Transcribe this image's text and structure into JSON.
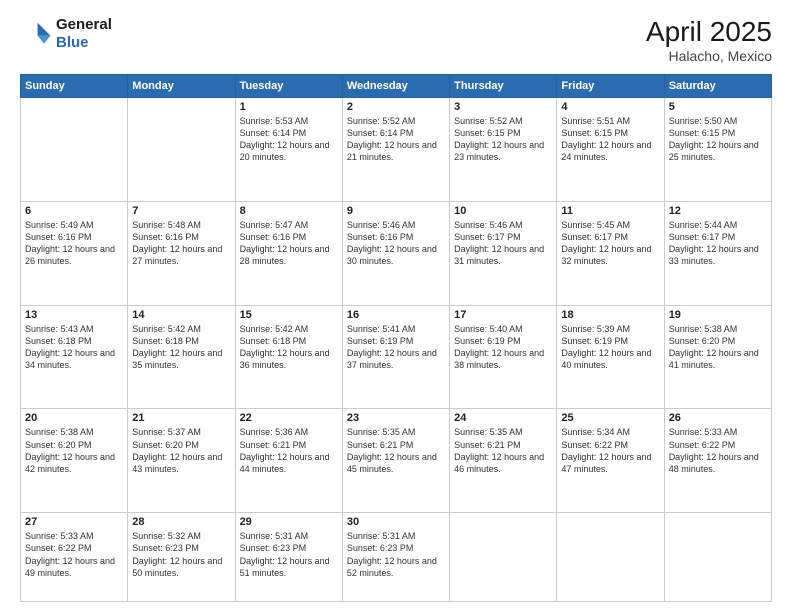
{
  "logo": {
    "line1": "General",
    "line2": "Blue"
  },
  "title": {
    "month_year": "April 2025",
    "location": "Halacho, Mexico"
  },
  "days_of_week": [
    "Sunday",
    "Monday",
    "Tuesday",
    "Wednesday",
    "Thursday",
    "Friday",
    "Saturday"
  ],
  "weeks": [
    [
      {
        "day": "",
        "text": ""
      },
      {
        "day": "",
        "text": ""
      },
      {
        "day": "1",
        "text": "Sunrise: 5:53 AM\nSunset: 6:14 PM\nDaylight: 12 hours and 20 minutes."
      },
      {
        "day": "2",
        "text": "Sunrise: 5:52 AM\nSunset: 6:14 PM\nDaylight: 12 hours and 21 minutes."
      },
      {
        "day": "3",
        "text": "Sunrise: 5:52 AM\nSunset: 6:15 PM\nDaylight: 12 hours and 23 minutes."
      },
      {
        "day": "4",
        "text": "Sunrise: 5:51 AM\nSunset: 6:15 PM\nDaylight: 12 hours and 24 minutes."
      },
      {
        "day": "5",
        "text": "Sunrise: 5:50 AM\nSunset: 6:15 PM\nDaylight: 12 hours and 25 minutes."
      }
    ],
    [
      {
        "day": "6",
        "text": "Sunrise: 5:49 AM\nSunset: 6:16 PM\nDaylight: 12 hours and 26 minutes."
      },
      {
        "day": "7",
        "text": "Sunrise: 5:48 AM\nSunset: 6:16 PM\nDaylight: 12 hours and 27 minutes."
      },
      {
        "day": "8",
        "text": "Sunrise: 5:47 AM\nSunset: 6:16 PM\nDaylight: 12 hours and 28 minutes."
      },
      {
        "day": "9",
        "text": "Sunrise: 5:46 AM\nSunset: 6:16 PM\nDaylight: 12 hours and 30 minutes."
      },
      {
        "day": "10",
        "text": "Sunrise: 5:46 AM\nSunset: 6:17 PM\nDaylight: 12 hours and 31 minutes."
      },
      {
        "day": "11",
        "text": "Sunrise: 5:45 AM\nSunset: 6:17 PM\nDaylight: 12 hours and 32 minutes."
      },
      {
        "day": "12",
        "text": "Sunrise: 5:44 AM\nSunset: 6:17 PM\nDaylight: 12 hours and 33 minutes."
      }
    ],
    [
      {
        "day": "13",
        "text": "Sunrise: 5:43 AM\nSunset: 6:18 PM\nDaylight: 12 hours and 34 minutes."
      },
      {
        "day": "14",
        "text": "Sunrise: 5:42 AM\nSunset: 6:18 PM\nDaylight: 12 hours and 35 minutes."
      },
      {
        "day": "15",
        "text": "Sunrise: 5:42 AM\nSunset: 6:18 PM\nDaylight: 12 hours and 36 minutes."
      },
      {
        "day": "16",
        "text": "Sunrise: 5:41 AM\nSunset: 6:19 PM\nDaylight: 12 hours and 37 minutes."
      },
      {
        "day": "17",
        "text": "Sunrise: 5:40 AM\nSunset: 6:19 PM\nDaylight: 12 hours and 38 minutes."
      },
      {
        "day": "18",
        "text": "Sunrise: 5:39 AM\nSunset: 6:19 PM\nDaylight: 12 hours and 40 minutes."
      },
      {
        "day": "19",
        "text": "Sunrise: 5:38 AM\nSunset: 6:20 PM\nDaylight: 12 hours and 41 minutes."
      }
    ],
    [
      {
        "day": "20",
        "text": "Sunrise: 5:38 AM\nSunset: 6:20 PM\nDaylight: 12 hours and 42 minutes."
      },
      {
        "day": "21",
        "text": "Sunrise: 5:37 AM\nSunset: 6:20 PM\nDaylight: 12 hours and 43 minutes."
      },
      {
        "day": "22",
        "text": "Sunrise: 5:36 AM\nSunset: 6:21 PM\nDaylight: 12 hours and 44 minutes."
      },
      {
        "day": "23",
        "text": "Sunrise: 5:35 AM\nSunset: 6:21 PM\nDaylight: 12 hours and 45 minutes."
      },
      {
        "day": "24",
        "text": "Sunrise: 5:35 AM\nSunset: 6:21 PM\nDaylight: 12 hours and 46 minutes."
      },
      {
        "day": "25",
        "text": "Sunrise: 5:34 AM\nSunset: 6:22 PM\nDaylight: 12 hours and 47 minutes."
      },
      {
        "day": "26",
        "text": "Sunrise: 5:33 AM\nSunset: 6:22 PM\nDaylight: 12 hours and 48 minutes."
      }
    ],
    [
      {
        "day": "27",
        "text": "Sunrise: 5:33 AM\nSunset: 6:22 PM\nDaylight: 12 hours and 49 minutes."
      },
      {
        "day": "28",
        "text": "Sunrise: 5:32 AM\nSunset: 6:23 PM\nDaylight: 12 hours and 50 minutes."
      },
      {
        "day": "29",
        "text": "Sunrise: 5:31 AM\nSunset: 6:23 PM\nDaylight: 12 hours and 51 minutes."
      },
      {
        "day": "30",
        "text": "Sunrise: 5:31 AM\nSunset: 6:23 PM\nDaylight: 12 hours and 52 minutes."
      },
      {
        "day": "",
        "text": ""
      },
      {
        "day": "",
        "text": ""
      },
      {
        "day": "",
        "text": ""
      }
    ]
  ]
}
